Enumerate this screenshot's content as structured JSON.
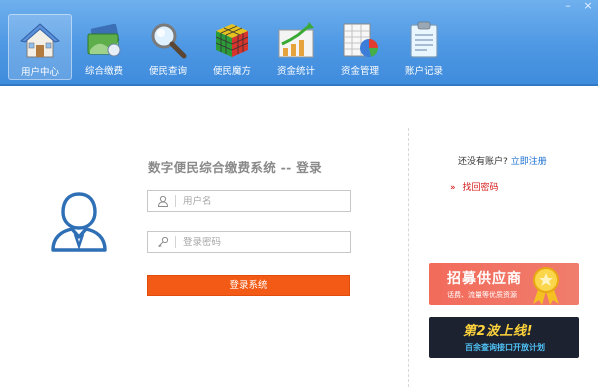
{
  "window": {
    "minimize_icon": "minimize-icon",
    "close_icon": "close-icon"
  },
  "toolbar": {
    "items": [
      {
        "label": "用户中心",
        "icon": "house-icon",
        "active": true
      },
      {
        "label": "综合缴费",
        "icon": "payment-icon",
        "active": false
      },
      {
        "label": "便民查询",
        "icon": "magnifier-icon",
        "active": false
      },
      {
        "label": "便民魔方",
        "icon": "rubiks-cube-icon",
        "active": false
      },
      {
        "label": "资金统计",
        "icon": "growth-chart-icon",
        "active": false
      },
      {
        "label": "资金管理",
        "icon": "spreadsheet-pie-icon",
        "active": false
      },
      {
        "label": "账户记录",
        "icon": "clipboard-icon",
        "active": false
      }
    ]
  },
  "login": {
    "title": "数字便民综合缴费系统 -- 登录",
    "username_placeholder": "用户名",
    "password_placeholder": "登录密码",
    "submit_label": "登录系统"
  },
  "side": {
    "no_account_text": "还没有账户?",
    "register_link": "立即注册",
    "forgot_arrow": "»",
    "forgot_link": "找回密码"
  },
  "banners": {
    "supplier_title": "招募供应商",
    "supplier_sub": "话费、流量等优质资源",
    "wave2_title": "第2波上线!",
    "wave2_sub": "百余查询接口开放计划"
  },
  "colors": {
    "toolbar": "#4d97e3",
    "login_button": "#f25a16",
    "link_blue": "#1a6fd1",
    "link_red": "#d41a1a",
    "avatar_blue": "#2f6fb5"
  }
}
